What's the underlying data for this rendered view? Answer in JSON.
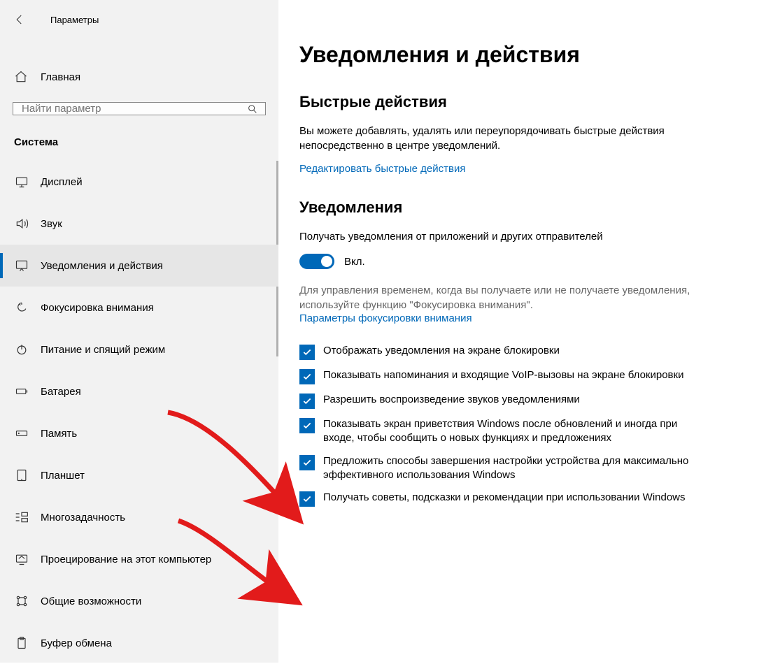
{
  "window": {
    "title": "Параметры"
  },
  "sidebar": {
    "home_label": "Главная",
    "search_placeholder": "Найти параметр",
    "category_label": "Система",
    "items": [
      {
        "label": "Дисплей"
      },
      {
        "label": "Звук"
      },
      {
        "label": "Уведомления и действия"
      },
      {
        "label": "Фокусировка внимания"
      },
      {
        "label": "Питание и спящий режим"
      },
      {
        "label": "Батарея"
      },
      {
        "label": "Память"
      },
      {
        "label": "Планшет"
      },
      {
        "label": "Многозадачность"
      },
      {
        "label": "Проецирование на этот компьютер"
      },
      {
        "label": "Общие возможности"
      },
      {
        "label": "Буфер обмена"
      }
    ]
  },
  "main": {
    "title": "Уведомления и действия",
    "quick_actions": {
      "heading": "Быстрые действия",
      "text": "Вы можете добавлять, удалять или переупорядочивать быстрые действия непосредственно в центре уведомлений.",
      "link": "Редактировать быстрые действия"
    },
    "notifications": {
      "heading": "Уведомления",
      "toggle_label": "Получать уведомления от приложений и других отправителей",
      "toggle_state": "Вкл.",
      "hint": "Для управления временем, когда вы получаете или не получаете уведомления, используйте функцию \"Фокусировка внимания\".",
      "focus_link": "Параметры фокусировки внимания",
      "checkboxes": [
        "Отображать уведомления на экране блокировки",
        "Показывать напоминания и входящие VoIP-вызовы на экране блокировки",
        "Разрешить  воспроизведение звуков уведомлениями",
        "Показывать экран приветствия Windows после обновлений и иногда при входе, чтобы сообщить о новых функциях и предложениях",
        "Предложить способы завершения настройки устройства для максимально эффективного использования Windows",
        "Получать советы, подсказки и рекомендации при использовании Windows"
      ]
    }
  }
}
